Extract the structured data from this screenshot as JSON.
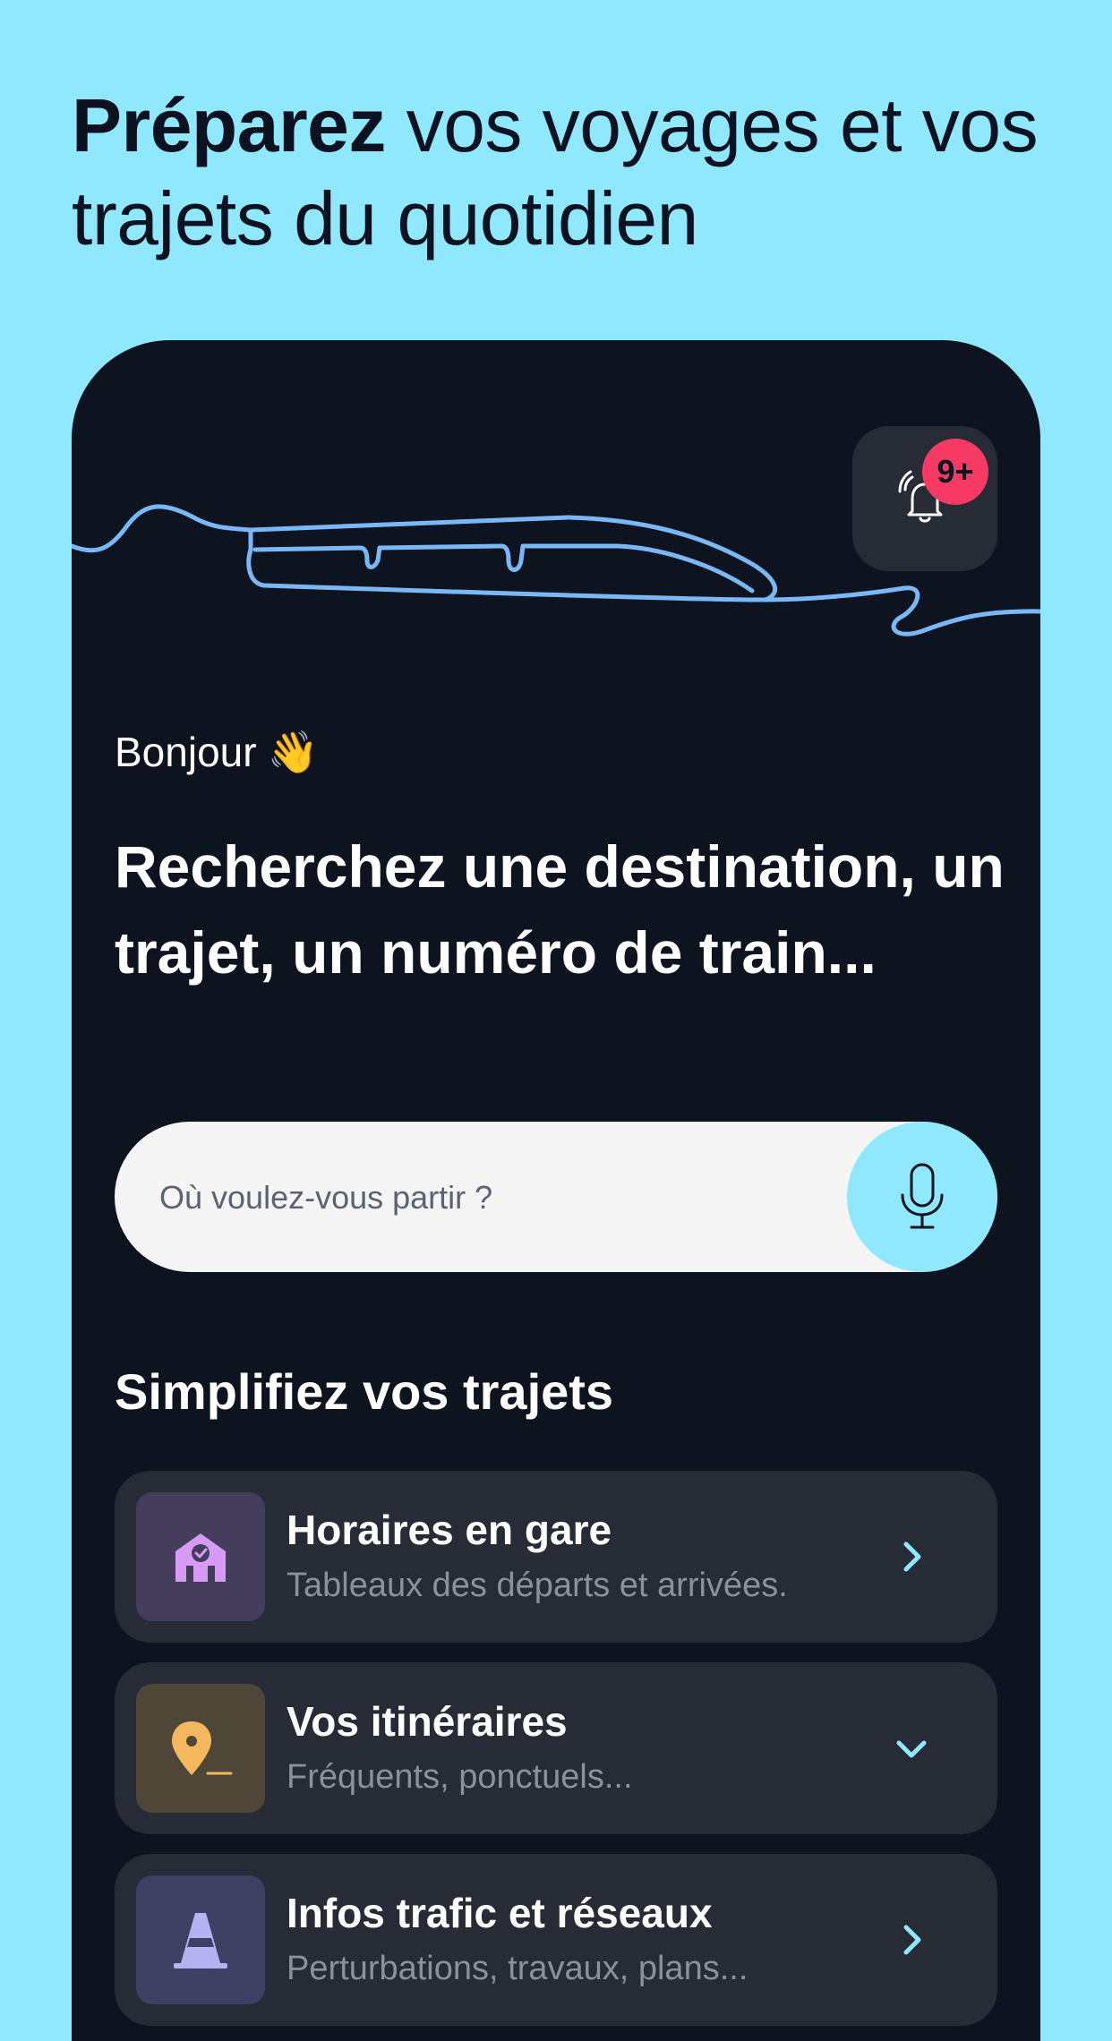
{
  "hero": {
    "title_strong": "Préparez",
    "title_rest": " vos voyages et vos trajets du quotidien"
  },
  "header": {
    "notification_badge": "9+"
  },
  "home": {
    "greeting": "Bonjour",
    "greeting_emoji": "👋",
    "headline": "Recherchez une destination, un trajet, un numéro de train..."
  },
  "search": {
    "placeholder": "Où voulez-vous partir ?",
    "value": ""
  },
  "section": {
    "title": "Simplifiez vos trajets"
  },
  "cards": [
    {
      "title": "Horaires en gare",
      "subtitle": "Tableaux des départs et arrivées.",
      "icon": "station-icon",
      "chevron": "right"
    },
    {
      "title": "Vos itinéraires",
      "subtitle": "Fréquents, ponctuels...",
      "icon": "location-pin-icon",
      "chevron": "down"
    },
    {
      "title": "Infos trafic et réseaux",
      "subtitle": "Perturbations, travaux, plans...",
      "icon": "traffic-cone-icon",
      "chevron": "right"
    }
  ],
  "colors": {
    "background": "#8fe8fe",
    "card_dark": "#0d131f",
    "tile": "#262b36",
    "accent": "#8fe8fe",
    "badge": "#f63a64",
    "line": "#7ab8f5",
    "station_icon": "#d69cf5",
    "station_icon_bg": "#443d5c",
    "pin_icon": "#f5b85e",
    "pin_icon_bg": "#4e4636",
    "cone_icon": "#b7b2f2",
    "cone_icon_bg": "#3e4163"
  }
}
